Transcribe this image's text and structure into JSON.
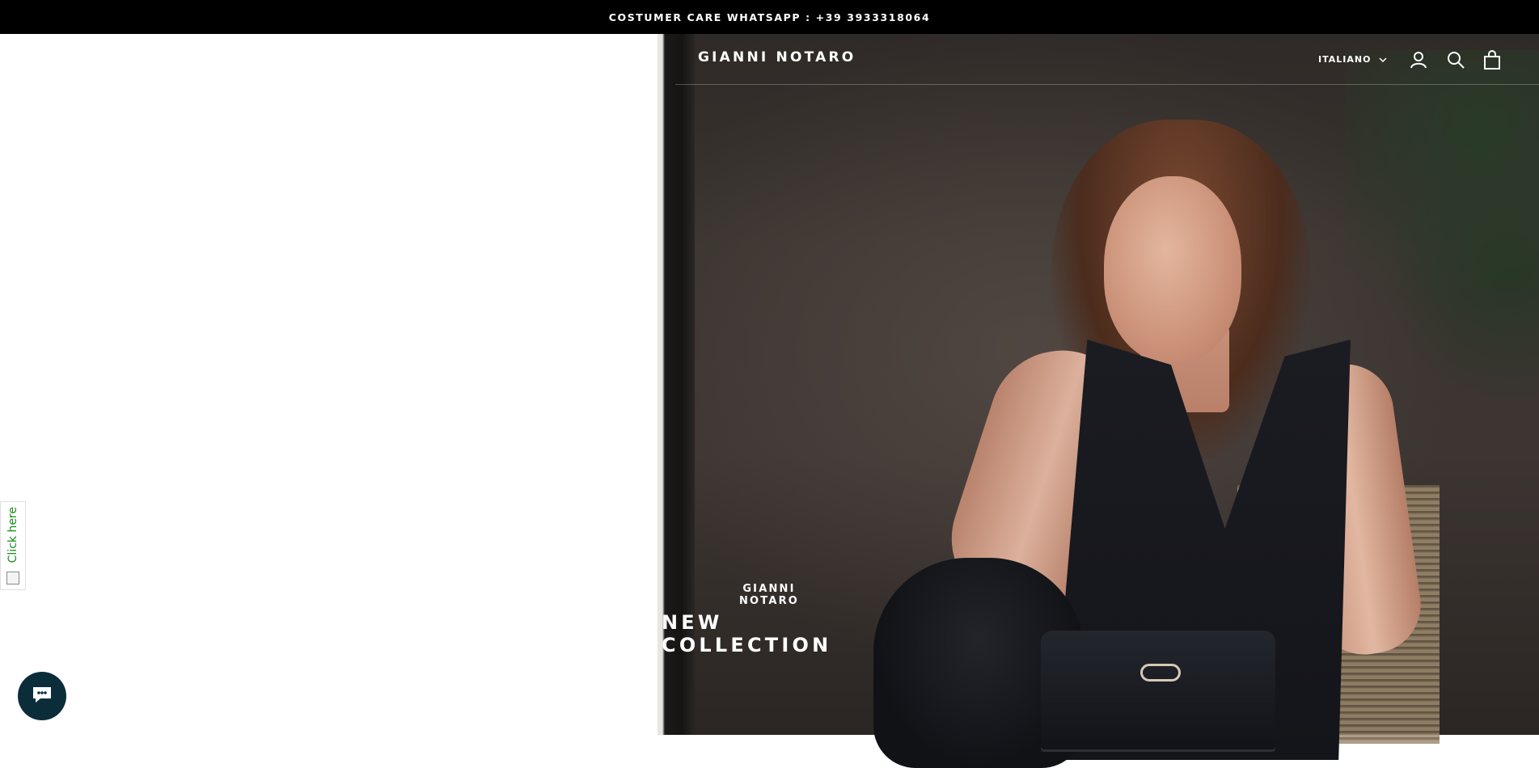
{
  "announcement": {
    "text": "COSTUMER CARE WHATSAPP : +39 3933318064"
  },
  "header": {
    "logo": "GIANNI NOTARO",
    "language": "ITALIANO",
    "icons": [
      "account-icon",
      "search-icon",
      "cart-icon",
      "chevron-down-icon"
    ]
  },
  "hero": {
    "subtitle": "GIANNI NOTARO",
    "title": "NEW COLLECTION"
  },
  "side_tab": {
    "label": "Click here"
  },
  "chat": {
    "icon": "chat-bubble-icon"
  },
  "colors": {
    "announcement_bg": "#000000",
    "text_on_dark": "#ffffff",
    "click_tab_text": "#1a8a1a",
    "chat_bg": "#0b2d3a"
  }
}
